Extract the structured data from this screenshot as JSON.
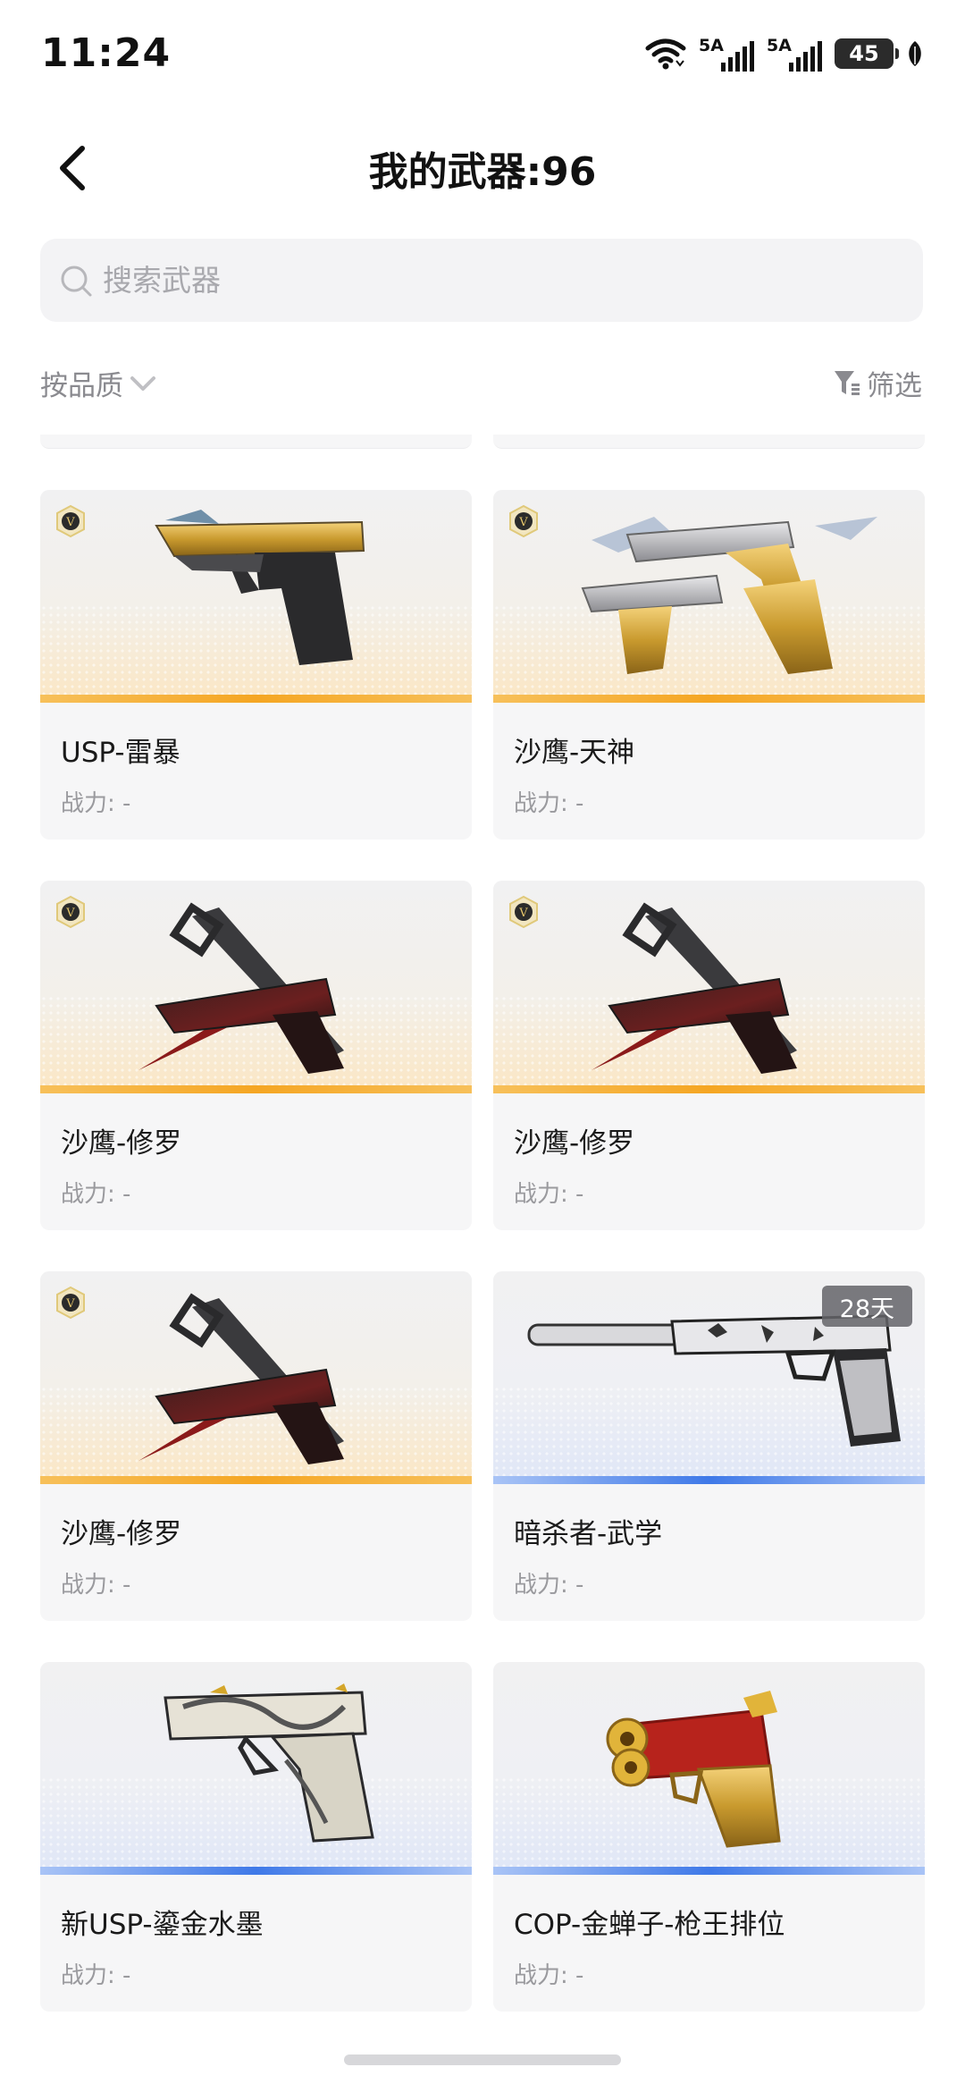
{
  "status_bar": {
    "time": "11:24",
    "sim1_label": "5A",
    "sim2_label": "5A",
    "battery": "45",
    "icons": [
      "wifi-icon",
      "signal-icon",
      "signal-icon",
      "battery-icon",
      "leaf-icon"
    ]
  },
  "header": {
    "title": "我的武器:96",
    "back_icon": "chevron-left-icon"
  },
  "search": {
    "placeholder": "搜索武器",
    "value": ""
  },
  "filters": {
    "sort_label": "按品质",
    "filter_label": "筛选"
  },
  "colors": {
    "gold_stripe": "#f5a623",
    "blue_stripe": "#3f79e8",
    "card_bg": "#f6f6f7",
    "search_bg": "#f3f3f5"
  },
  "weapons": [
    {
      "name": "USP-雷暴",
      "power": "战力: -",
      "quality": "gold",
      "vip": true,
      "days": ""
    },
    {
      "name": "沙鹰-天神",
      "power": "战力: -",
      "quality": "gold",
      "vip": true,
      "days": ""
    },
    {
      "name": "沙鹰-修罗",
      "power": "战力: -",
      "quality": "gold",
      "vip": true,
      "days": ""
    },
    {
      "name": "沙鹰-修罗",
      "power": "战力: -",
      "quality": "gold",
      "vip": true,
      "days": ""
    },
    {
      "name": "沙鹰-修罗",
      "power": "战力: -",
      "quality": "gold",
      "vip": true,
      "days": ""
    },
    {
      "name": "暗杀者-武学",
      "power": "战力: -",
      "quality": "blue",
      "vip": false,
      "days": "28天"
    },
    {
      "name": "新USP-鎏金水墨",
      "power": "战力: -",
      "quality": "blue",
      "vip": false,
      "days": ""
    },
    {
      "name": "COP-金蝉子-枪王排位",
      "power": "战力: -",
      "quality": "blue",
      "vip": false,
      "days": ""
    }
  ]
}
